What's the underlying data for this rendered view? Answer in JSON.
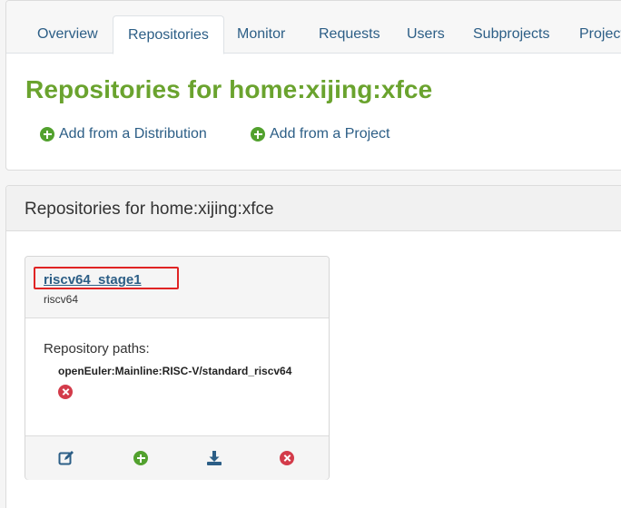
{
  "tabs": [
    {
      "label": "Overview",
      "active": false
    },
    {
      "label": "Repositories",
      "active": true
    },
    {
      "label": "Monitor",
      "active": false
    },
    {
      "label": "Requests",
      "active": false
    },
    {
      "label": "Users",
      "active": false
    },
    {
      "label": "Subprojects",
      "active": false
    },
    {
      "label": "Project",
      "active": false
    }
  ],
  "page_title": "Repositories for home:xijing:xfce",
  "actions": {
    "add_from_distribution": "Add from a Distribution",
    "add_from_project": "Add from a Project"
  },
  "repositories_card": {
    "title": "Repositories for home:xijing:xfce"
  },
  "repository": {
    "name": "riscv64_stage1",
    "arch": "riscv64",
    "paths_label": "Repository paths:",
    "paths": [
      "openEuler:Mainline:RISC-V/standard_riscv64"
    ]
  },
  "colors": {
    "accent_green": "#6aa32e",
    "link_blue": "#2c5e86",
    "add_green": "#52a12e",
    "delete_red": "#d33b4a",
    "highlight_red": "#e02424"
  },
  "icons": {
    "add": "plus-circle-icon",
    "remove": "times-circle-icon",
    "edit": "edit-icon",
    "download": "download-icon"
  }
}
